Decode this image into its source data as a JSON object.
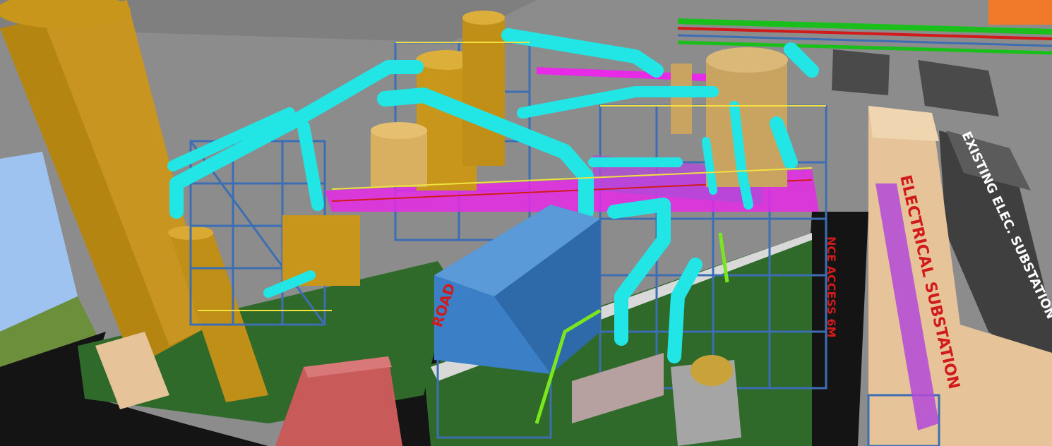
{
  "viewport": {
    "title": "",
    "description_labels": {
      "electrical_substation": "ELECTRICAL SUBSTATION",
      "existing_substation": "EXISTING ELEC. SUBSTATION",
      "access_road": "NCE ACCESS 6M",
      "road": "ROAD",
      "building_small_label_1": "",
      "building_small_label_2": ""
    }
  },
  "colors": {
    "ground_gray": "#8c8c8c",
    "sky": "#9ec3f0",
    "grass": "#2f6a2b",
    "road": "#141414",
    "tank_gold": "#c8961a",
    "pipe_cyan": "#22e6e6",
    "steel_blue": "#3c6eb4",
    "magenta": "#e62ae6",
    "building_blue": "#3b7fc6",
    "building_tan": "#e6c399",
    "building_gray": "#4a4a4a",
    "red_building": "#c95a5a",
    "label_red": "#d11a1a",
    "label_white": "#ffffff"
  }
}
